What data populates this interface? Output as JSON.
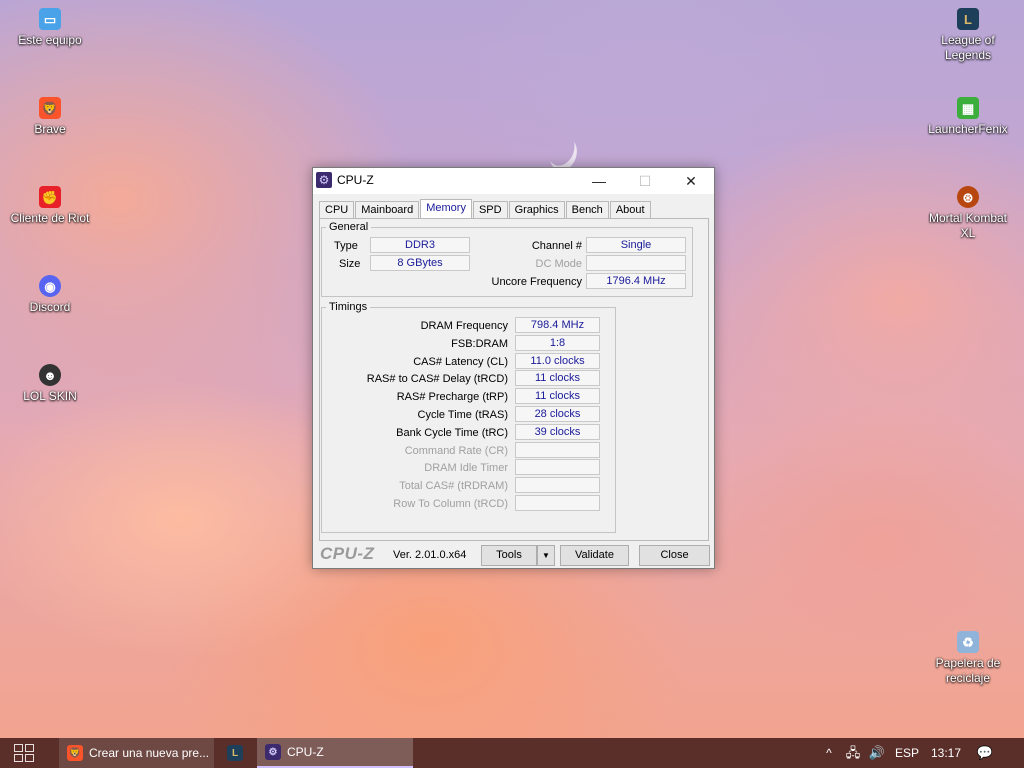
{
  "desktop": {
    "icons_left": [
      {
        "label": "Este equipo",
        "icon": "computer-icon",
        "glyph": "▭",
        "color": "#4aa3e8"
      },
      {
        "label": "Brave",
        "icon": "brave-icon",
        "glyph": "🦁",
        "color": "#fb542b"
      },
      {
        "label": "Cliente de Riot",
        "icon": "riot-client-icon",
        "glyph": "✊",
        "color": "#e8202a"
      },
      {
        "label": "Discord",
        "icon": "discord-icon",
        "glyph": "◉",
        "color": "#5865f2"
      },
      {
        "label": "LOL SKIN",
        "icon": "lol-skin-icon",
        "glyph": "☻",
        "color": "#333333"
      }
    ],
    "icons_right": [
      {
        "label": "League of Legends",
        "icon": "league-of-legends-icon",
        "glyph": "L",
        "color": "#1e3f5a"
      },
      {
        "label": "LauncherFenix",
        "icon": "launcherfenix-icon",
        "glyph": "▦",
        "color": "#3cae3c"
      },
      {
        "label": "Mortal Kombat XL",
        "icon": "mortal-kombat-icon",
        "glyph": "⊛",
        "color": "#b8470f"
      },
      {
        "label": "Papelera de reciclaje",
        "icon": "recycle-bin-icon",
        "glyph": "♻",
        "color": "#8fb3d9"
      }
    ]
  },
  "cpuz": {
    "title": "CPU-Z",
    "controls": {
      "minimize": "—",
      "maximize": "☐",
      "close": "✕"
    },
    "tabs": [
      "CPU",
      "Mainboard",
      "Memory",
      "SPD",
      "Graphics",
      "Bench",
      "About"
    ],
    "active_tab": "Memory",
    "general": {
      "legend": "General",
      "type_label": "Type",
      "type_value": "DDR3",
      "size_label": "Size",
      "size_value": "8 GBytes",
      "channel_label": "Channel #",
      "channel_value": "Single",
      "dc_mode_label": "DC Mode",
      "dc_mode_value": "",
      "uncore_label": "Uncore Frequency",
      "uncore_value": "1796.4 MHz"
    },
    "timings": {
      "legend": "Timings",
      "rows": [
        {
          "label": "DRAM Frequency",
          "value": "798.4 MHz",
          "enabled": true
        },
        {
          "label": "FSB:DRAM",
          "value": "1:8",
          "enabled": true
        },
        {
          "label": "CAS# Latency (CL)",
          "value": "11.0 clocks",
          "enabled": true
        },
        {
          "label": "RAS# to CAS# Delay (tRCD)",
          "value": "11 clocks",
          "enabled": true
        },
        {
          "label": "RAS# Precharge (tRP)",
          "value": "11 clocks",
          "enabled": true
        },
        {
          "label": "Cycle Time (tRAS)",
          "value": "28 clocks",
          "enabled": true
        },
        {
          "label": "Bank Cycle Time (tRC)",
          "value": "39 clocks",
          "enabled": true
        },
        {
          "label": "Command Rate (CR)",
          "value": "",
          "enabled": false
        },
        {
          "label": "DRAM Idle Timer",
          "value": "",
          "enabled": false
        },
        {
          "label": "Total CAS# (tRDRAM)",
          "value": "",
          "enabled": false
        },
        {
          "label": "Row To Column (tRCD)",
          "value": "",
          "enabled": false
        }
      ]
    },
    "footer": {
      "brand": "CPU-Z",
      "version": "Ver. 2.01.0.x64",
      "tools_label": "Tools",
      "tools_arrow": "▼",
      "validate_label": "Validate",
      "close_label": "Close"
    }
  },
  "taskbar": {
    "start_icon": "windows-start-icon",
    "tasks": [
      {
        "label": "Crear una nueva pre...",
        "icon": "brave-icon",
        "glyph": "🦁",
        "color": "#fb542b",
        "active": false
      },
      {
        "label": "",
        "icon": "league-of-legends-icon",
        "glyph": "L",
        "color": "#1e3f5a",
        "active": false
      },
      {
        "label": "CPU-Z",
        "icon": "cpuz-icon",
        "glyph": "⚙",
        "color": "#3b2a6e",
        "active": true
      }
    ],
    "tray": {
      "chevron": "^",
      "network_glyph": "🖧",
      "volume_glyph": "🔊",
      "language": "ESP",
      "time": "13:17",
      "notification_glyph": "💬"
    }
  }
}
